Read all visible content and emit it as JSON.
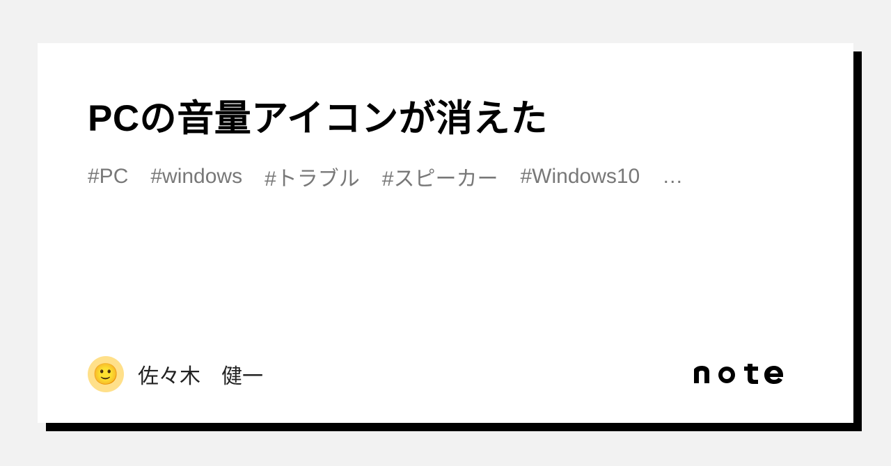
{
  "title": "PCの音量アイコンが消えた",
  "tags": [
    "#PC",
    "#windows",
    "#トラブル",
    "#スピーカー",
    "#Windows10"
  ],
  "tags_overflow": "…",
  "author": {
    "name": "佐々木　健一",
    "avatar_emoji": "🙂"
  },
  "brand": "note"
}
